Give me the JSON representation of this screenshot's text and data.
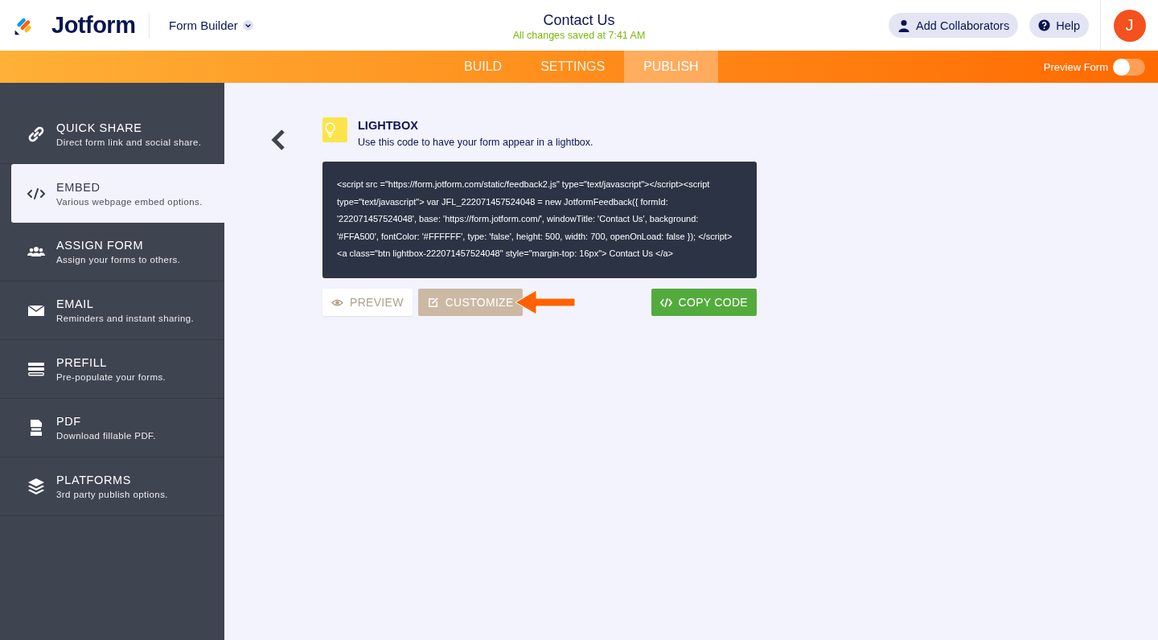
{
  "header": {
    "logo": "Jotform",
    "builder_menu": "Form Builder",
    "title": "Contact Us",
    "save_status": "All changes saved at 7:41 AM",
    "collaborators_button": "Add Collaborators",
    "help_button": "Help",
    "avatar": "J"
  },
  "tabs": [
    {
      "label": "BUILD",
      "selected": false
    },
    {
      "label": "SETTINGS",
      "selected": false
    },
    {
      "label": "PUBLISH",
      "selected": true
    }
  ],
  "preview_form": {
    "label": "Preview Form",
    "on": false
  },
  "sidebar": {
    "items": [
      {
        "title": "QUICK SHARE",
        "subtitle": "Direct form link and social share.",
        "selected": false
      },
      {
        "title": "EMBED",
        "subtitle": "Various webpage embed options.",
        "selected": true
      },
      {
        "title": "ASSIGN FORM",
        "subtitle": "Assign your forms to others.",
        "selected": false
      },
      {
        "title": "EMAIL",
        "subtitle": "Reminders and instant sharing.",
        "selected": false
      },
      {
        "title": "PREFILL",
        "subtitle": "Pre-populate your forms.",
        "selected": false
      },
      {
        "title": "PDF",
        "subtitle": "Download fillable PDF.",
        "selected": false
      },
      {
        "title": "PLATFORMS",
        "subtitle": "3rd party publish options.",
        "selected": false
      }
    ]
  },
  "panel": {
    "title": "LIGHTBOX",
    "description": "Use this code to have your form appear in a lightbox.",
    "code": "<script src =\"https://form.jotform.com/static/feedback2.js\" type=\"text/javascript\"></script><script type=\"text/javascript\"> var JFL_222071457524048 = new JotformFeedback({ formId: '222071457524048', base: 'https://form.jotform.com/', windowTitle: 'Contact Us', background: '#FFA500', fontColor: '#FFFFFF', type: 'false', height: 500, width: 700, openOnLoad: false }); </script> <a class=\"btn lightbox-222071457524048\" style=\"margin-top: 16px\"> Contact Us </a>",
    "buttons": [
      {
        "kind": "preview",
        "label": "PREVIEW"
      },
      {
        "kind": "customize",
        "label": "CUSTOMIZE"
      },
      {
        "kind": "copy",
        "label": "COPY CODE"
      }
    ]
  }
}
